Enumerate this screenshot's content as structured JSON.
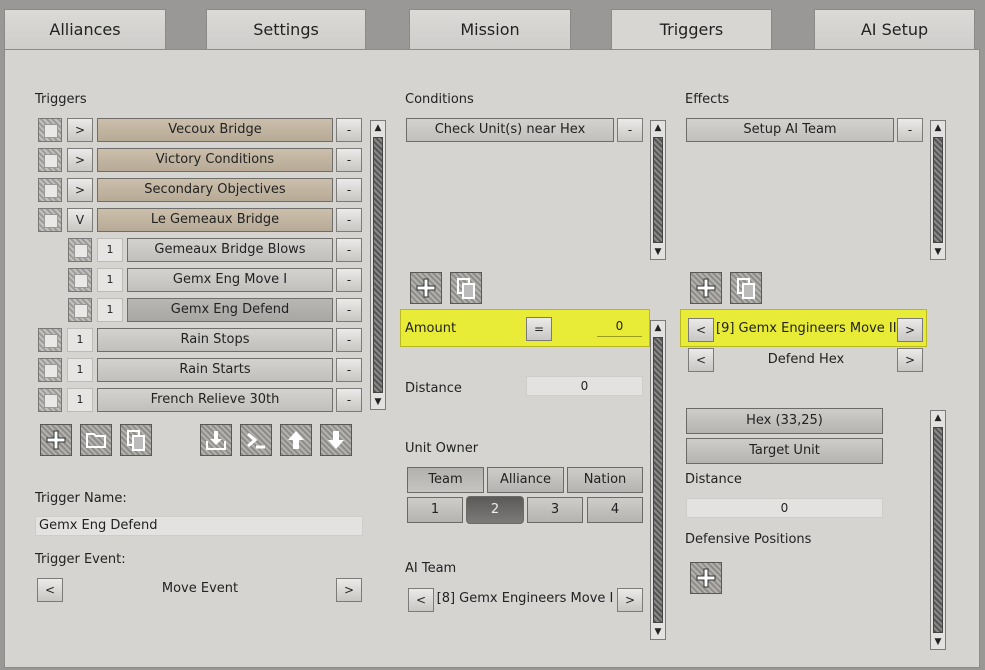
{
  "tabs": [
    "Alliances",
    "Settings",
    "Mission",
    "Triggers",
    "AI Setup"
  ],
  "triggers": {
    "header": "Triggers",
    "items": [
      {
        "expander": ">",
        "label": "Vecoux Bridge",
        "style": "tan",
        "indent": 0
      },
      {
        "expander": ">",
        "label": "Victory Conditions",
        "style": "tan",
        "indent": 0
      },
      {
        "expander": ">",
        "label": "Secondary Objectives",
        "style": "tan",
        "indent": 0
      },
      {
        "expander": "V",
        "label": "Le Gemeaux Bridge",
        "style": "tan",
        "indent": 0
      },
      {
        "expander": "1",
        "label": "Gemeaux Bridge Blows",
        "style": "grey",
        "indent": 1
      },
      {
        "expander": "1",
        "label": "Gemx Eng Move I",
        "style": "grey",
        "indent": 1
      },
      {
        "expander": "1",
        "label": "Gemx Eng Defend",
        "style": "sel",
        "indent": 1
      },
      {
        "expander": "1",
        "label": "Rain Stops",
        "style": "grey",
        "indent": 0
      },
      {
        "expander": "1",
        "label": "Rain Starts",
        "style": "grey",
        "indent": 0
      },
      {
        "expander": "1",
        "label": "French Relieve 30th",
        "style": "grey",
        "indent": 0
      }
    ],
    "remove_label": "-",
    "trigger_name_label": "Trigger Name:",
    "trigger_name_value": "Gemx Eng Defend",
    "trigger_event_label": "Trigger Event:",
    "trigger_event_value": "Move Event",
    "prev": "<",
    "next": ">"
  },
  "conditions": {
    "header": "Conditions",
    "items": [
      "Check Unit(s) near Hex"
    ],
    "remove_label": "-",
    "amount_label": "Amount",
    "amount_operator": "=",
    "amount_value": "0",
    "distance_label": "Distance",
    "distance_value": "0",
    "unit_owner_label": "Unit Owner",
    "owner_options": [
      "Team",
      "Alliance",
      "Nation"
    ],
    "owner_selected": "Team",
    "team_numbers": [
      "1",
      "2",
      "3",
      "4"
    ],
    "team_selected": "2",
    "ai_team_label": "AI Team",
    "ai_team_value": "[8] Gemx Engineers Move I",
    "prev": "<",
    "next": ">"
  },
  "effects": {
    "header": "Effects",
    "items": [
      "Setup AI Team"
    ],
    "remove_label": "-",
    "team_value": "[9] Gemx Engineers Move II",
    "order_value": "Defend Hex",
    "hex_button": "Hex (33,25)",
    "target_unit_button": "Target Unit",
    "distance_label": "Distance",
    "distance_value": "0",
    "defensive_label": "Defensive Positions",
    "prev": "<",
    "next": ">"
  },
  "colors": {
    "highlight": "#e8ec36",
    "panel": "#d6d4d1",
    "tan_row": "#c4b8a5"
  }
}
